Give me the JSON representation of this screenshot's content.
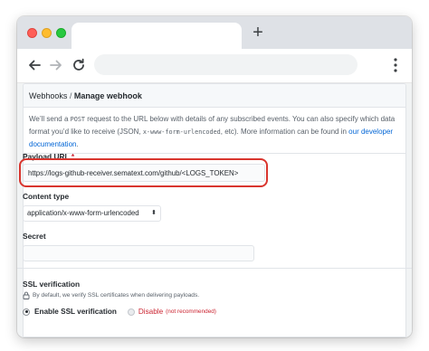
{
  "browser": {
    "new_tab_label": "+",
    "address_value": "",
    "menu_icon": "kebab-menu-icon"
  },
  "breadcrumb": {
    "parent": "Webhooks",
    "separator": "/",
    "current": "Manage webhook"
  },
  "intro": {
    "part1": "We’ll send a ",
    "post_code": "POST",
    "part2": " request to the URL below with details of any subscribed events. You can also specify which data format you’d like to receive (JSON, ",
    "format_code": "x-www-form-urlencoded",
    "part3": ", etc). More information can be found in ",
    "link_text": "our developer documentation",
    "part4": "."
  },
  "payload_url": {
    "label": "Payload URL",
    "required_mark": "*",
    "value": "https://logs-github-receiver.sematext.com/github/<LOGS_TOKEN>"
  },
  "content_type": {
    "label": "Content type",
    "selected": "application/x-www-form-urlencoded",
    "arrows": "⬍"
  },
  "secret": {
    "label": "Secret",
    "value": ""
  },
  "ssl": {
    "title": "SSL verification",
    "note": "By default, we verify SSL certificates when delivering payloads.",
    "enable_label": "Enable SSL verification",
    "disable_label": "Disable",
    "disable_note": "(not recommended)"
  },
  "colors": {
    "link": "#0366d6",
    "highlight_ring": "#d9352e",
    "danger": "#cb2431"
  }
}
